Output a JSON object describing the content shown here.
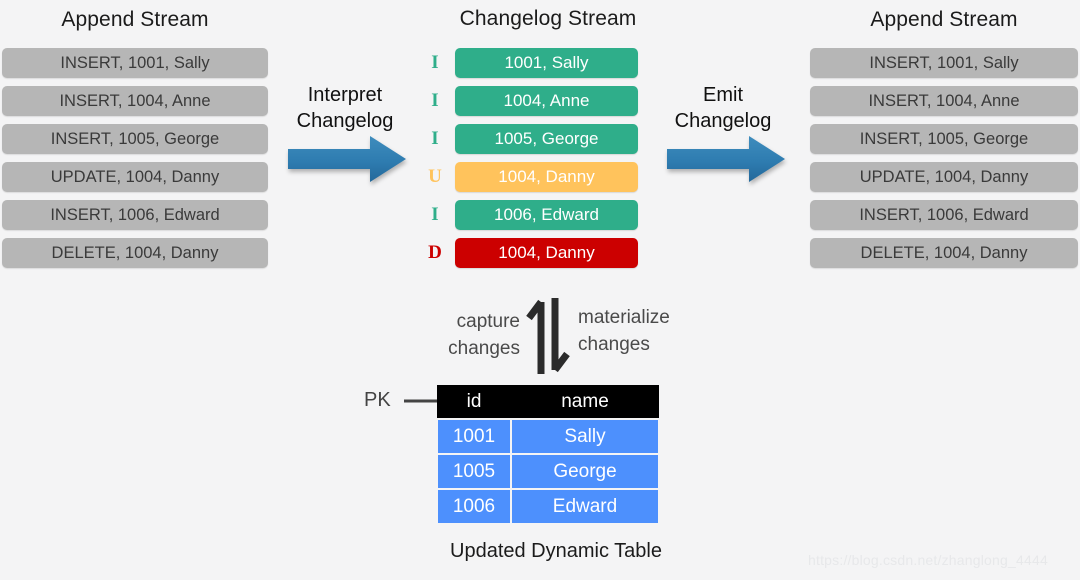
{
  "background": "#f4f4f5",
  "colors": {
    "pill_bg": "#b6b6b6",
    "pill_text": "#3a3a3a",
    "insert_green": "#2fae8a",
    "update_amber": "#ffc35c",
    "delete_red": "#cc0000",
    "arrow_blue": "#2e7cb0",
    "table_header_bg": "#000000",
    "table_row_bg": "#4d90fd",
    "vert_arrow": "#2b2b2b"
  },
  "left_column": {
    "title": "Append Stream",
    "rows": [
      "INSERT, 1001, Sally",
      "INSERT, 1004, Anne",
      "INSERT, 1005, George",
      "UPDATE, 1004, Danny",
      "INSERT, 1006, Edward",
      "DELETE, 1004, Danny"
    ]
  },
  "center_column": {
    "title": "Changelog Stream",
    "rows": [
      {
        "op": "I",
        "text": "1001, Sally",
        "color": "#2fae8a"
      },
      {
        "op": "I",
        "text": "1004, Anne",
        "color": "#2fae8a"
      },
      {
        "op": "I",
        "text": "1005, George",
        "color": "#2fae8a"
      },
      {
        "op": "U",
        "text": "1004, Danny",
        "color": "#ffc35c"
      },
      {
        "op": "I",
        "text": "1006, Edward",
        "color": "#2fae8a"
      },
      {
        "op": "D",
        "text": "1004, Danny",
        "color": "#cc0000"
      }
    ]
  },
  "right_column": {
    "title": "Append Stream",
    "rows": [
      "INSERT, 1001, Sally",
      "INSERT, 1004, Anne",
      "INSERT, 1005, George",
      "UPDATE, 1004, Danny",
      "INSERT, 1006, Edward",
      "DELETE, 1004, Danny"
    ]
  },
  "flows": {
    "interpret_label_line1": "Interpret",
    "interpret_label_line2": "Changelog",
    "emit_label_line1": "Emit",
    "emit_label_line2": "Changelog"
  },
  "vertical_flow": {
    "capture_line1": "capture",
    "capture_line2": "changes",
    "materialize_line1": "materialize",
    "materialize_line2": "changes"
  },
  "dynamic_table": {
    "pk_label": "PK",
    "headers": [
      "id",
      "name"
    ],
    "rows": [
      [
        "1001",
        "Sally"
      ],
      [
        "1005",
        "George"
      ],
      [
        "1006",
        "Edward"
      ]
    ],
    "caption": "Updated Dynamic Table"
  },
  "watermark": "https://blog.csdn.net/zhanglong_4444"
}
